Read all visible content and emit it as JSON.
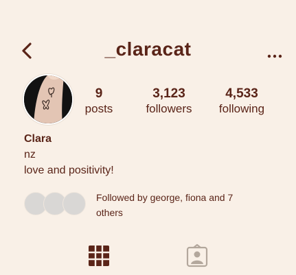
{
  "header": {
    "username": "_claracat",
    "back_icon": "chevron-left-icon",
    "more_icon": "more-horizontal-icon"
  },
  "profile": {
    "avatar_icon": "tattoo-photo-avatar",
    "stats": {
      "posts_count": "9",
      "posts_label": "posts",
      "followers_count": "3,123",
      "followers_label": "followers",
      "following_count": "4,533",
      "following_label": "following"
    },
    "display_name": "Clara",
    "bio": [
      "nz",
      "love and positivity!"
    ]
  },
  "followed_by": {
    "text": "Followed by george, fiona and 7 others"
  },
  "tabs": [
    {
      "icon": "grid-icon",
      "active": true
    },
    {
      "icon": "tagged-icon",
      "active": false
    }
  ],
  "colors": {
    "background": "#f9f0e7",
    "text": "#5a2418",
    "inactive_tab": "#b3a79c",
    "placeholder_avatar": "#d9d7d5"
  }
}
